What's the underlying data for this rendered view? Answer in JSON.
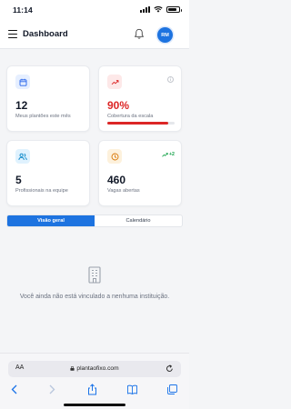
{
  "status_bar": {
    "time": "11:14"
  },
  "header": {
    "title": "Dashboard",
    "avatar_initials": "RM"
  },
  "cards": [
    {
      "value": "12",
      "label": "Meus plantões este mês",
      "icon": "calendar-icon",
      "accent": "#2563eb"
    },
    {
      "value": "90%",
      "label": "Cobertura da escala",
      "icon": "trend-up-icon",
      "accent": "#dc2626",
      "progress": 0.9,
      "info_icon": "info-icon"
    },
    {
      "value": "5",
      "label": "Profissionais na equipe",
      "icon": "users-icon",
      "accent": "#0284c7"
    },
    {
      "value": "460",
      "label": "Vagas abertas",
      "icon": "clock-icon",
      "accent": "#d97706",
      "trend": "+2"
    }
  ],
  "tabs": [
    {
      "label": "Visão geral",
      "active": true
    },
    {
      "label": "Calendário",
      "active": false
    }
  ],
  "empty_state": {
    "icon": "building-icon",
    "text": "Você ainda não está vinculado a nenhuma instituição."
  },
  "browser": {
    "text_size_label": "AA",
    "url": "plantaofixo.com"
  },
  "colors": {
    "primary": "#1d73e0",
    "danger": "#dc2626",
    "success": "#16a34a",
    "background": "#f4f5f7"
  }
}
